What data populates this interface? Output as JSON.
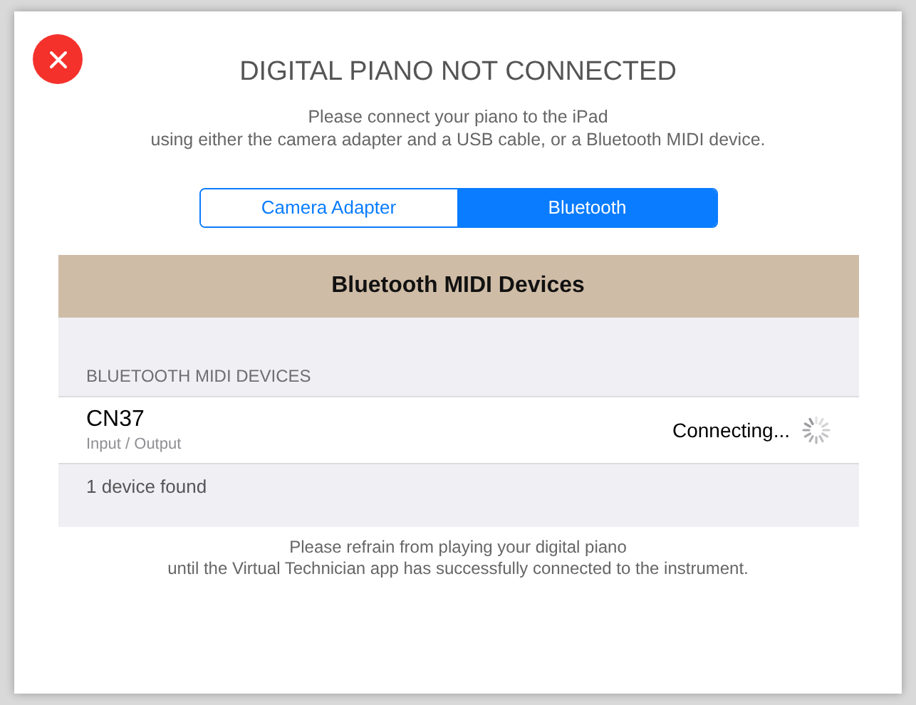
{
  "title": "DIGITAL PIANO NOT CONNECTED",
  "subtitle": [
    "Please connect your piano to the iPad",
    "using either the camera adapter and a USB cable, or a Bluetooth MIDI device."
  ],
  "tabs": [
    {
      "label": "Camera Adapter",
      "selected": false
    },
    {
      "label": "Bluetooth",
      "selected": true
    }
  ],
  "panel": {
    "header": "Bluetooth MIDI Devices",
    "section": "BLUETOOTH MIDI DEVICES",
    "devices": [
      {
        "name": "CN37",
        "detail": "Input / Output",
        "status": "Connecting...",
        "busy": true
      }
    ],
    "footer": "1 device found"
  },
  "note": [
    "Please refrain from playing your digital piano",
    "until the Virtual Technician app has successfully connected to the instrument."
  ]
}
